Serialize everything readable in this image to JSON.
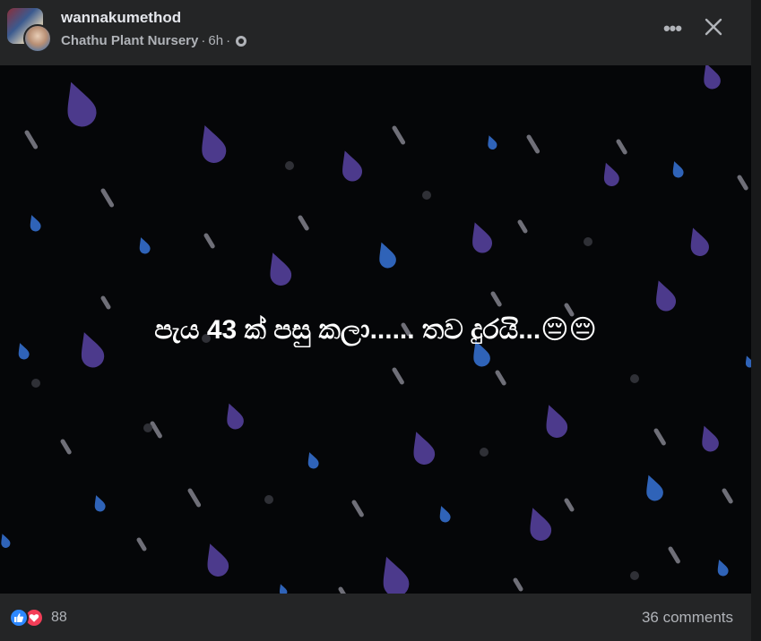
{
  "header": {
    "author": "wannakumethod",
    "group": "Chathu Plant Nursery",
    "time": "6h",
    "separator": "·",
    "privacy_icon": "public-globe-icon",
    "more_icon": "more-options-icon",
    "close_icon": "close-icon"
  },
  "post": {
    "text": "පැය 43 ක් පසු කලා...... තව දුරයි...😔😔",
    "background": "#050608",
    "drop_colors": [
      "#4c3a8c",
      "#2f63b8",
      "#6f6f78"
    ]
  },
  "footer": {
    "reaction_icons": [
      "like-icon",
      "love-icon"
    ],
    "reaction_count": "88",
    "comments": "36 comments"
  },
  "colors": {
    "panel": "#242526",
    "text_primary": "#e4e6eb",
    "text_secondary": "#b0b3b8",
    "like": "#2d88ff",
    "love": "#f33e58"
  }
}
